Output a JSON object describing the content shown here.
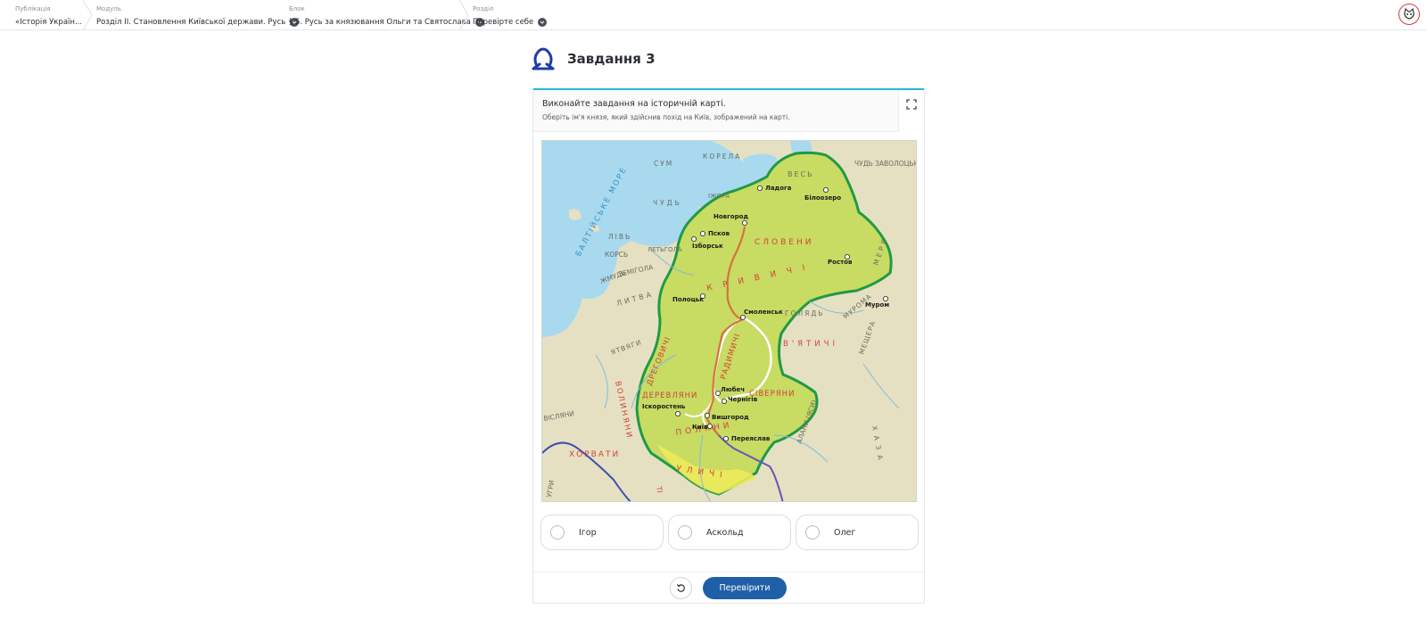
{
  "breadcrumbs": [
    {
      "caption": "Публікація",
      "value": "«Історія Україн..."
    },
    {
      "caption": "Модуль",
      "value": "Розділ ІІ. Становлення Київської держави. Русь"
    },
    {
      "caption": "Блок",
      "value": "§ 5. Русь за князювання Ольги та Святослава"
    },
    {
      "caption": "Розділ",
      "value": "Перевірте себе"
    }
  ],
  "task": {
    "title": "Завдання 3",
    "instruction": "Виконайте завдання на історичній карті.",
    "question": "Оберіть ім'я князя, який здійснив похід на Київ, зображений на карті."
  },
  "options": [
    {
      "label": "Ігор"
    },
    {
      "label": "Аскольд"
    },
    {
      "label": "Олег"
    }
  ],
  "actions": {
    "check_label": "Перевірити"
  },
  "map": {
    "sea_label": "БАЛТІЙСЬКЕ МОРЕ",
    "cities": [
      "Ладога",
      "Білоозеро",
      "Новгород",
      "Псков",
      "Ізборськ",
      "Ростов",
      "Полоцьк",
      "Смоленськ",
      "Муром",
      "Любеч",
      "Чернігів",
      "Іскоростень",
      "Вишгород",
      "Київ",
      "Переяслав"
    ],
    "tribes_red": [
      "СЛОВЕНИ",
      "КРИВИЧІ",
      "ДРЕГОВИЧІ",
      "РАДИМИЧІ",
      "В'ЯТИЧІ",
      "ДЕРЕВЛЯНИ",
      "СІВЕРЯНИ",
      "ПОЛЯНИ",
      "УЛИЧІ",
      "ХОРВАТИ",
      "ВОЛИНЯНИ",
      "ТІ"
    ],
    "tribes_grey": [
      "ЧУДЬ",
      "СУМ",
      "КОРЕЛА",
      "ІЖОРА",
      "ВЕСЬ",
      "ЧУДЬ ЗАВОЛОЦЬКА",
      "ЛІВЬ",
      "КОРСЬ",
      "ЗЕМІГОЛА",
      "ЛЕТЬГОЛА",
      "ЖМУДЬ",
      "ЛИТВА",
      "ЯТВЯГИ",
      "ГОЛЯДЬ",
      "МУРОМА",
      "МЕЩЕРА",
      "МЕРЯ",
      "АЛАНИ (ЯСИ)",
      "ХАЗА",
      "ВІСЛЯНИ",
      "УГРИ"
    ],
    "colors": {
      "land": "#e6e0c2",
      "water": "#9fd6ee",
      "rus": "#c8db63",
      "border": "#1f9a45",
      "route": "#d4733e"
    }
  },
  "colors": {
    "accent": "#27b7d6",
    "primary": "#1f5fa8",
    "task_icon": "#1f3ca8"
  }
}
